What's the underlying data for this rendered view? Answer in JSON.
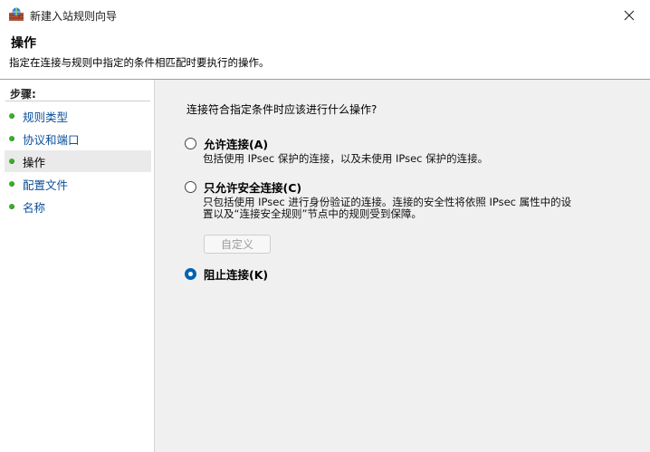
{
  "window": {
    "title": "新建入站规则向导"
  },
  "header": {
    "title": "操作",
    "description": "指定在连接与规则中指定的条件相匹配时要执行的操作。"
  },
  "sidebar": {
    "steps_label": "步骤:",
    "items": [
      {
        "label": "规则类型",
        "active": false
      },
      {
        "label": "协议和端口",
        "active": false
      },
      {
        "label": "操作",
        "active": true
      },
      {
        "label": "配置文件",
        "active": false
      },
      {
        "label": "名称",
        "active": false
      }
    ]
  },
  "main": {
    "question": "连接符合指定条件时应该进行什么操作?",
    "options": [
      {
        "label": "允许连接(A)",
        "description": "包括使用 IPsec 保护的连接，以及未使用 IPsec 保护的连接。",
        "checked": false
      },
      {
        "label": "只允许安全连接(C)",
        "description_line1": "只包括使用 IPsec 进行身份验证的连接。连接的安全性将依照 IPsec 属性中的设",
        "description_line2": "置以及“连接安全规则”节点中的规则受到保障。",
        "checked": false
      },
      {
        "label": "阻止连接(K)",
        "checked": true
      }
    ],
    "custom_button": "自定义"
  },
  "colors": {
    "accent": "#0063b1",
    "link": "#0b4f9a",
    "bullet": "#3cae2c"
  }
}
